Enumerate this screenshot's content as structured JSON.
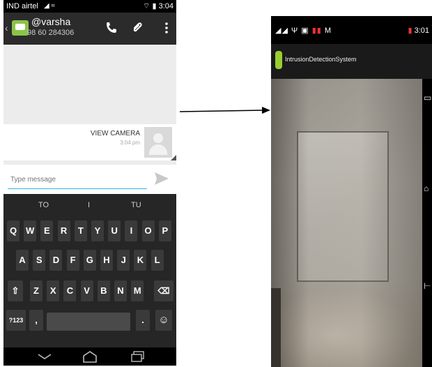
{
  "left_phone": {
    "status": {
      "carrier": "IND airtel",
      "time": "3:04"
    },
    "header": {
      "contact_name": "@varsha",
      "contact_number": "98 60 284306"
    },
    "message": {
      "text": "VIEW CAMERA",
      "time": "3:04 pm"
    },
    "compose": {
      "placeholder": "Type message"
    },
    "keyboard": {
      "suggestions": [
        "TO",
        "I",
        "TU"
      ],
      "row1": [
        "Q",
        "W",
        "E",
        "R",
        "T",
        "Y",
        "U",
        "I",
        "O",
        "P"
      ],
      "row2": [
        "A",
        "S",
        "D",
        "F",
        "G",
        "H",
        "J",
        "K",
        "L"
      ],
      "row3": [
        "Z",
        "X",
        "C",
        "V",
        "B",
        "N",
        "M"
      ],
      "symbols_label": "?123",
      "comma": ",",
      "period": "."
    }
  },
  "right_phone": {
    "status": {
      "time": "3:01"
    },
    "app": {
      "title": "IntrusionDetectionSystem"
    }
  },
  "colors": {
    "accent": "#33b5e5",
    "keyboard_bg": "#262626",
    "actionbar_bg": "#2b2b2b"
  }
}
